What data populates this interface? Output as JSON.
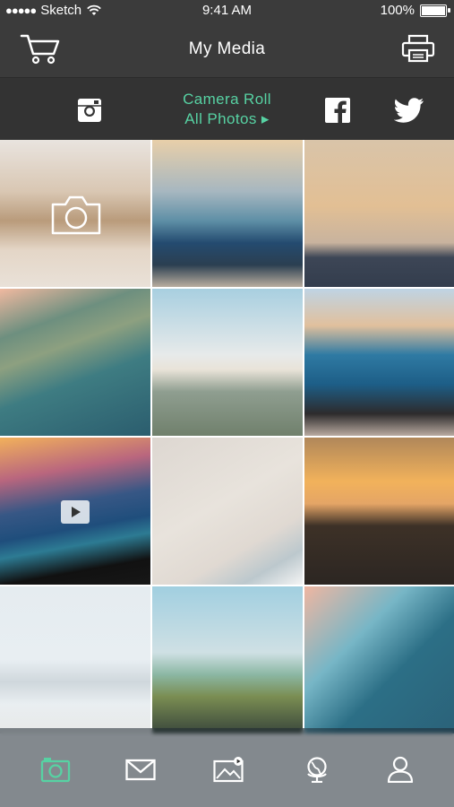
{
  "status_bar": {
    "carrier": "Sketch",
    "time": "9:41 AM",
    "battery": "100%"
  },
  "header": {
    "title": "My Media"
  },
  "source_bar": {
    "source_title": "Camera Roll",
    "source_subtitle": "All Photos ▸"
  },
  "colors": {
    "accent": "#57d2a3",
    "bar": "#3b3b3b"
  },
  "grid": {
    "tiles": [
      {
        "name": "camera-tile",
        "overlay": "camera-icon"
      },
      {
        "name": "photo"
      },
      {
        "name": "photo"
      },
      {
        "name": "photo"
      },
      {
        "name": "photo"
      },
      {
        "name": "photo"
      },
      {
        "name": "video",
        "overlay": "play-icon"
      },
      {
        "name": "photo"
      },
      {
        "name": "photo"
      },
      {
        "name": "photo"
      },
      {
        "name": "photo"
      },
      {
        "name": "photo"
      }
    ]
  },
  "tab_bar": {
    "items": [
      {
        "icon": "camera-icon",
        "active": true
      },
      {
        "icon": "mail-icon",
        "active": false
      },
      {
        "icon": "gallery-icon",
        "active": false
      },
      {
        "icon": "globe-icon",
        "active": false
      },
      {
        "icon": "user-icon",
        "active": false
      }
    ]
  }
}
